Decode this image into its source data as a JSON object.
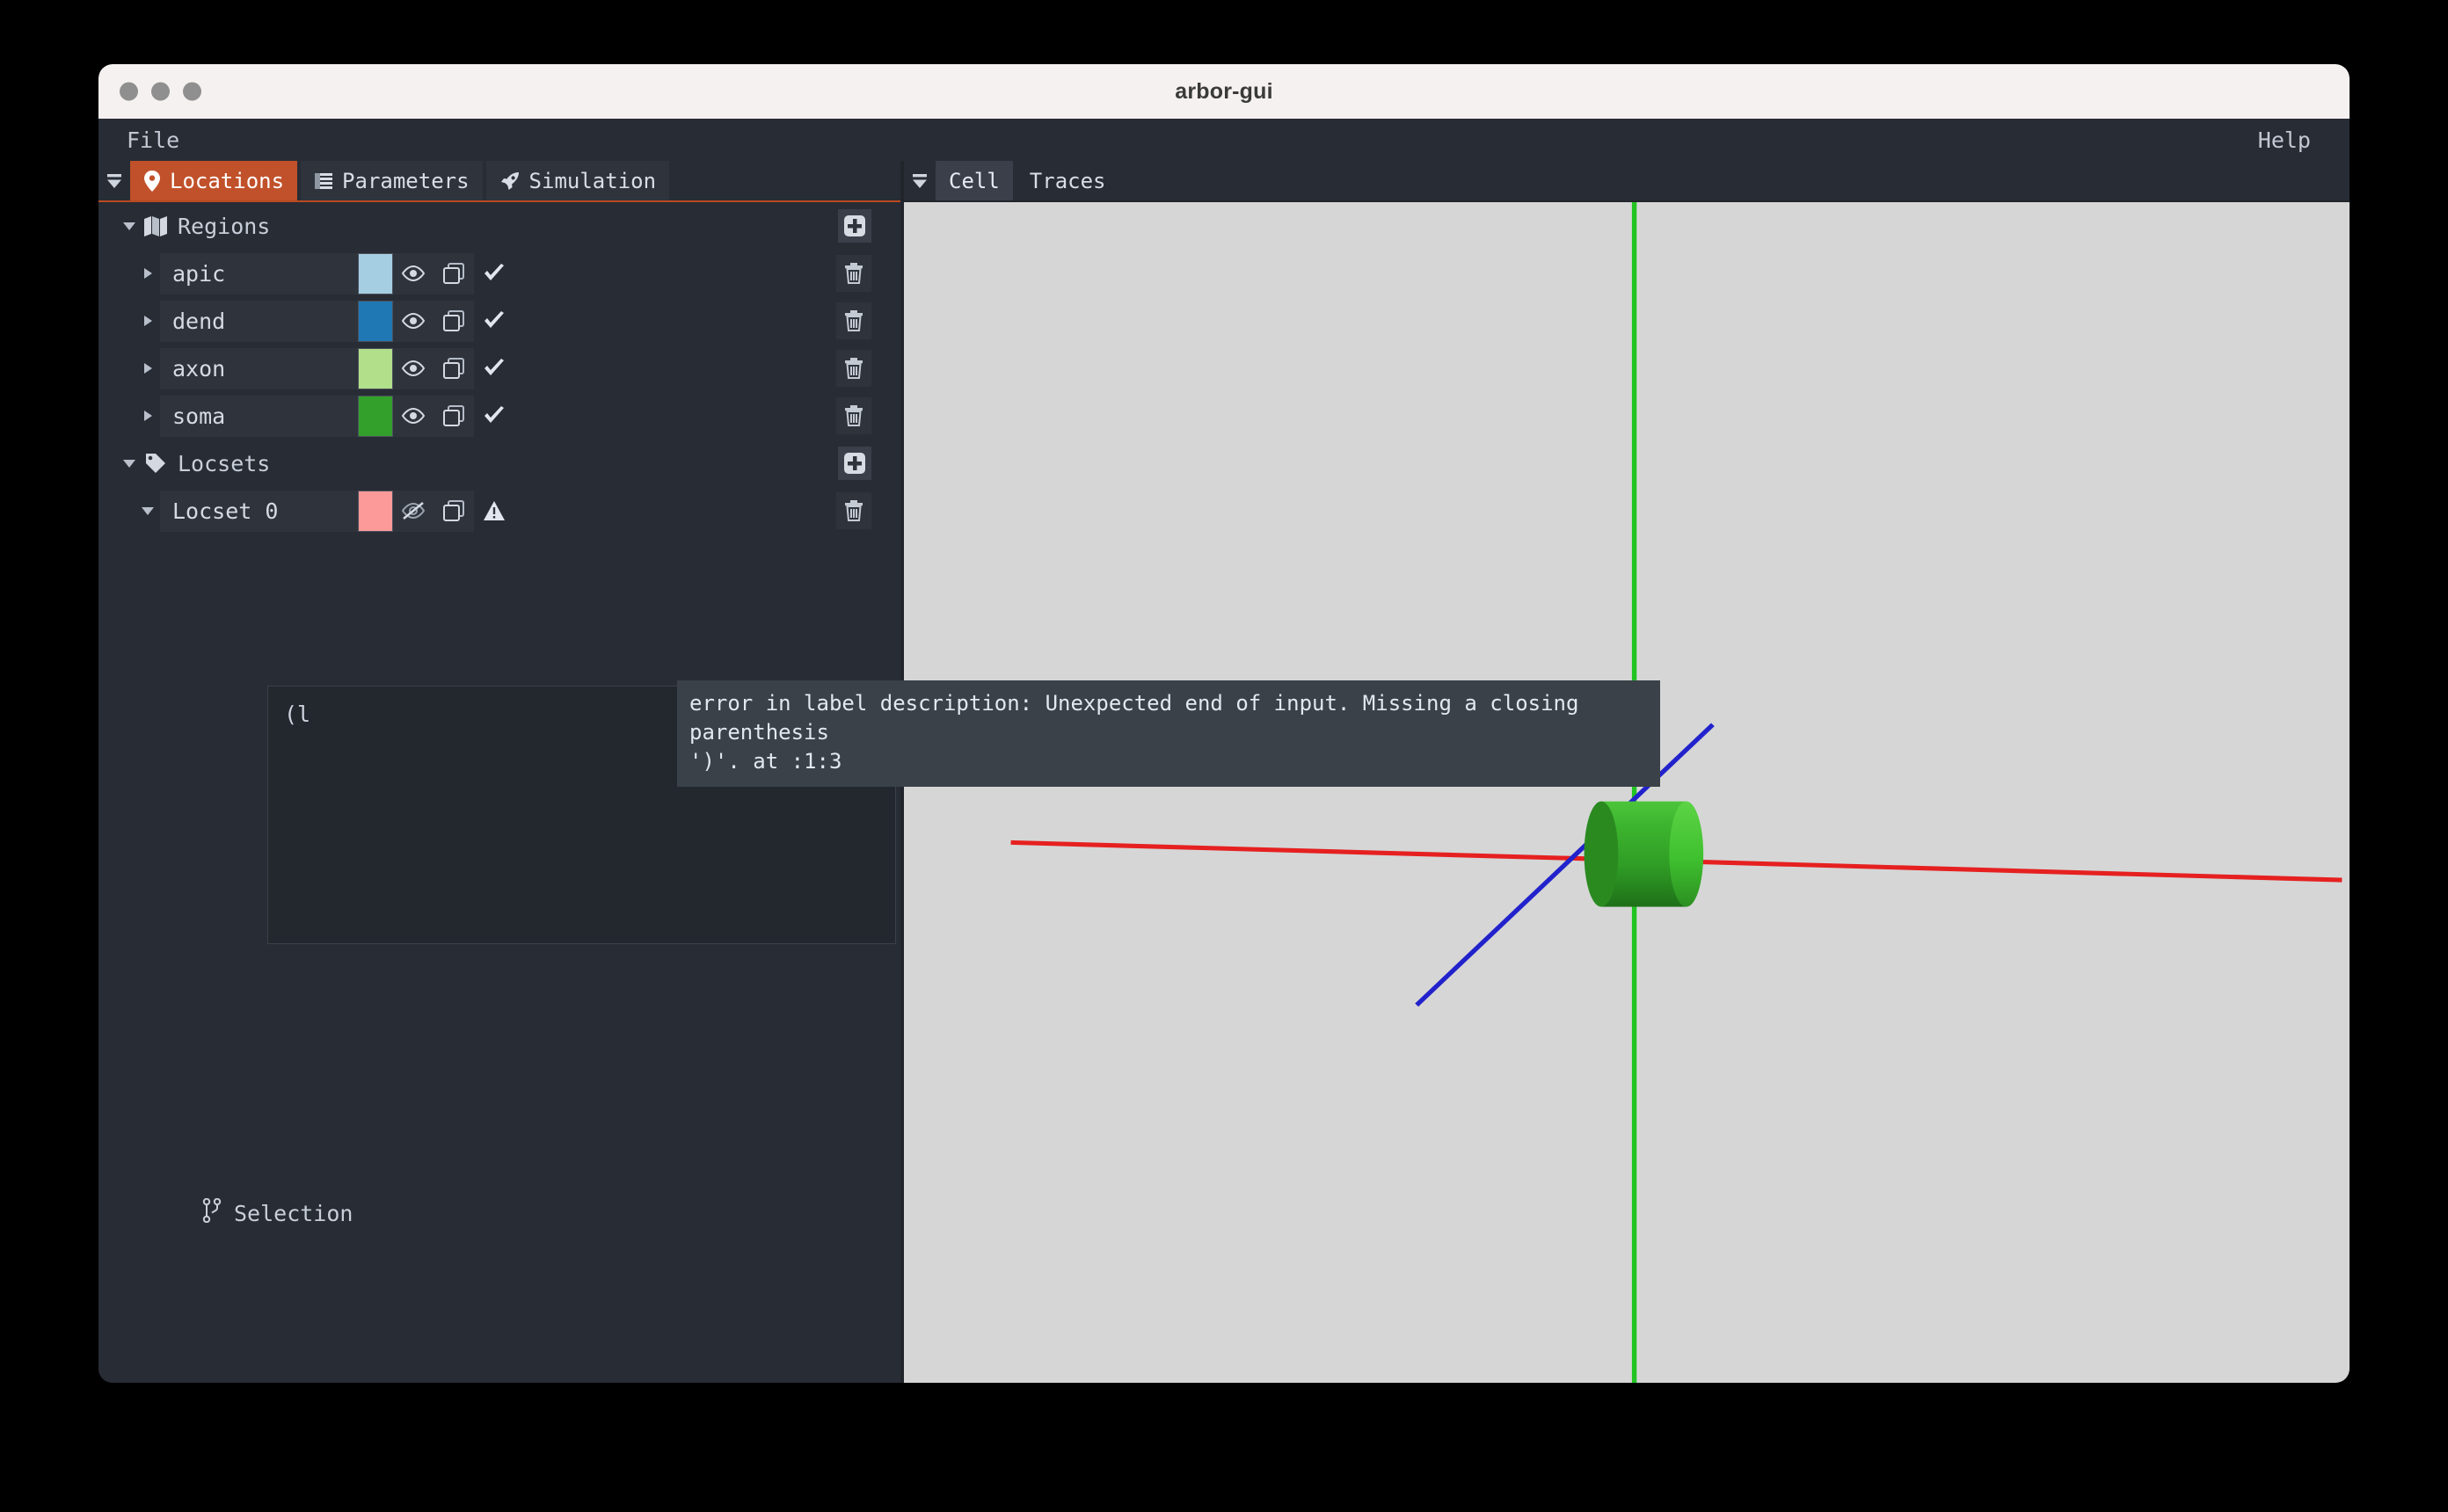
{
  "window": {
    "title": "arbor-gui",
    "traffic_lights": [
      "close-button",
      "minimize-button",
      "maximize-button"
    ]
  },
  "menubar": {
    "file_label": "File",
    "help_label": "Help"
  },
  "left_panel": {
    "tabs": [
      {
        "label": "Locations",
        "icon": "map-pin-icon",
        "active": true
      },
      {
        "label": "Parameters",
        "icon": "list-icon",
        "active": false
      },
      {
        "label": "Simulation",
        "icon": "rocket-icon",
        "active": false
      }
    ],
    "regions": {
      "label": "Regions",
      "icon": "map-icon",
      "expanded": true,
      "add_icon": "plus-square-icon",
      "items": [
        {
          "name": "apic",
          "color": "#a6cee3",
          "visible": true,
          "visibility_icon": "eye-icon",
          "copy_icon": "copy-icon",
          "status_icon": "check-icon",
          "delete_icon": "trash-icon"
        },
        {
          "name": "dend",
          "color": "#1f78b4",
          "visible": true,
          "visibility_icon": "eye-icon",
          "copy_icon": "copy-icon",
          "status_icon": "check-icon",
          "delete_icon": "trash-icon"
        },
        {
          "name": "axon",
          "color": "#b2df8a",
          "visible": true,
          "visibility_icon": "eye-icon",
          "copy_icon": "copy-icon",
          "status_icon": "check-icon",
          "delete_icon": "trash-icon"
        },
        {
          "name": "soma",
          "color": "#33a02c",
          "visible": true,
          "visibility_icon": "eye-icon",
          "copy_icon": "copy-icon",
          "status_icon": "check-icon",
          "delete_icon": "trash-icon"
        }
      ]
    },
    "locsets": {
      "label": "Locsets",
      "icon": "tag-icon",
      "expanded": true,
      "add_icon": "plus-square-icon",
      "items": [
        {
          "name": "Locset 0",
          "color": "#fb9a99",
          "visible": false,
          "visibility_icon": "eye-slash-icon",
          "copy_icon": "copy-icon",
          "status_icon": "warning-triangle-icon",
          "delete_icon": "trash-icon",
          "expanded": true
        }
      ]
    },
    "editor": {
      "value": "(l",
      "placeholder": ""
    },
    "error_tooltip": {
      "line1": "error in label description: Unexpected end of input. Missing a closing parenthesis",
      "line2": "')'. at :1:3"
    },
    "selection": {
      "label": "Selection",
      "icon": "branch-icon"
    }
  },
  "right_panel": {
    "tabs": [
      {
        "label": "Cell",
        "active": true
      },
      {
        "label": "Traces",
        "active": false
      }
    ],
    "viewport": {
      "background_color": "#d6d6d6",
      "x_axis_color": "#e62020",
      "y_axis_color": "#22c422",
      "z_axis_color": "#2222cc",
      "soma_color": "#33a02c",
      "soma_shape": "cylinder"
    }
  },
  "theme": {
    "accent": "#c1512a",
    "panel_bg": "#282c34",
    "row_bg": "#2f333c",
    "text": "#c9cfda"
  }
}
